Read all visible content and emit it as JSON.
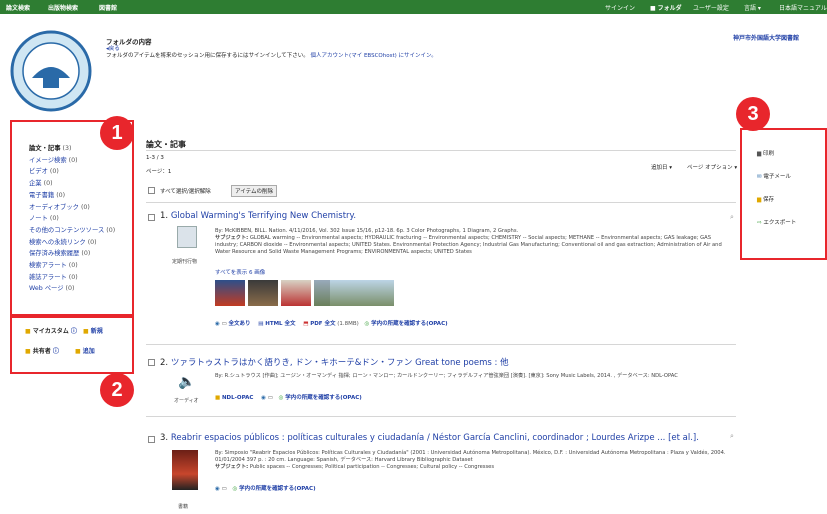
{
  "topbar": {
    "left": [
      "論文検索",
      "出版物検索",
      "図書館"
    ],
    "right": [
      "サインイン",
      "フォルダ",
      "ユーザー設定",
      "言語 ▾",
      "日本語マニュアル"
    ]
  },
  "library_name": "神戸市外国語大学図書館",
  "folder": {
    "title": "フォルダの内容",
    "back": "◂戻る",
    "notice_text": "フォルダのアイテムを将来のセッション用に保存するにはサインインして下さい。",
    "notice_link": "個人アカウント(マイ EBSCOhost) にサインイン。"
  },
  "sidebar": {
    "items": [
      {
        "label": "論文・記事",
        "count": "(3)"
      },
      {
        "label": "イメージ検索",
        "count": "(0)"
      },
      {
        "label": "ビデオ",
        "count": "(0)"
      },
      {
        "label": "企業",
        "count": "(0)"
      },
      {
        "label": "電子書籍",
        "count": "(0)"
      },
      {
        "label": "オーディオブック",
        "count": "(0)"
      },
      {
        "label": "ノート",
        "count": "(0)"
      },
      {
        "label": "その他のコンテンツソース",
        "count": "(0)"
      },
      {
        "label": "検索への永続リンク",
        "count": "(0)"
      },
      {
        "label": "保存済み検索履歴",
        "count": "(0)"
      },
      {
        "label": "検索アラート",
        "count": "(0)"
      },
      {
        "label": "雑誌アラート",
        "count": "(0)"
      },
      {
        "label": "Web ページ",
        "count": "(0)"
      }
    ],
    "custom": {
      "label": "マイカスタム",
      "new": "新規"
    },
    "shared": {
      "label": "共有者",
      "add": "追加"
    }
  },
  "main": {
    "heading": "論文・記事",
    "range": "1-3 / 3",
    "page": "ページ：1",
    "sort": "追加日 ▾",
    "page_options": "ページ オプション ▾",
    "select_all": "すべて選択/選択解除",
    "delete_button": "アイテムの削除"
  },
  "results": [
    {
      "num": "1.",
      "title": "Global Warming's Terrifying New Chemistry.",
      "by": "By: McKIBBEN, BILL. Nation. 4/11/2016, Vol. 302 Issue 15/16, p12-18. 6p. 3 Color Photographs, 1 Diagram, 2 Graphs.",
      "subject_label": "サブジェクト:",
      "subjects": "GLOBAL warming -- Environmental aspects; HYDRAULIC fracturing -- Environmental aspects; CHEMISTRY -- Social aspects; METHANE -- Environmental aspects; GAS leakage; GAS industry; CARBON dioxide -- Environmental aspects; UNITED States. Environmental Protection Agency; Industrial Gas Manufacturing; Conventional oil and gas extraction; Administration of Air and Water Resource and Solid Waste Management Programs; ENVIRONMENTAL aspects; UNITED States",
      "type": "定期刊行物",
      "images_link": "すべてを表示 6 画像",
      "links": [
        "全文あり",
        "HTML 全文",
        "PDF 全文",
        "(1.8MB)",
        "学内の所蔵を確認する(OPAC)"
      ]
    },
    {
      "num": "2.",
      "title": "ツァラトゥストラはかく語りき, ドン・キホーテ&ドン・ファン Great tone poems : 他",
      "by": "By: R.シュトラウス [作曲]; ユージン・オーマンディ 指揮; ローン・マンロー; カールドンクーリー; フィラデルフィア管弦楽団 [演奏]. [東京]: Sony Music Labels, 2014. , データベース: NDL-OPAC",
      "type": "オーディオ",
      "links": [
        "NDL-OPAC",
        "学内の所蔵を確認する(OPAC)"
      ]
    },
    {
      "num": "3.",
      "title": "Reabrir espacios públicos : políticas culturales y ciudadanía / Néstor García Canclini, coordinador ; Lourdes Arizpe ... [et al.].",
      "by": "By: Simposio \"Reabrir Espacios Públicos: Políticas Culturales y Ciudadanía\" (2001 : Universidad Autónoma Metropolitana). México, D.F. : Universidad Autónoma Metropolitana : Plaza y Valdés, 2004. 01/01/2004 397 p. : 20 cm. Language: Spanish, データベース: Harvard Library Bibliographic Dataset",
      "subject_label": "サブジェクト:",
      "subjects": "Public spaces -- Congresses; Political participation -- Congresses; Cultural policy -- Congresses",
      "type": "書籍",
      "links": [
        "学内の所蔵を確認する(OPAC)"
      ]
    }
  ],
  "tools": [
    "印刷",
    "電子メール",
    "保存",
    "エクスポート"
  ],
  "badges": [
    "1",
    "2",
    "3"
  ],
  "colors": {
    "topbar": "#2e7d32",
    "badge": "#e8262c",
    "link": "#1f3fa6"
  }
}
